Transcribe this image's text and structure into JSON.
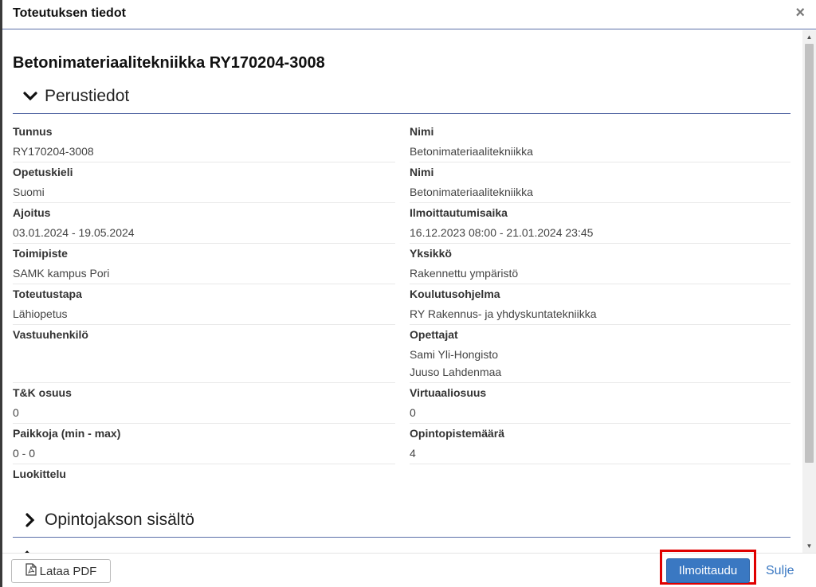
{
  "dialog": {
    "title": "Toteutuksen tiedot",
    "close_symbol": "×"
  },
  "course_title": "Betonimateriaalitekniikka RY170204-3008",
  "sections": {
    "basic": "Perustiedot",
    "content": "Opintojakson sisältö"
  },
  "fields": [
    {
      "label": "Tunnus",
      "values": [
        "RY170204-3008"
      ]
    },
    {
      "label": "Nimi",
      "values": [
        "Betonimateriaalitekniikka"
      ]
    },
    {
      "label": "Opetuskieli",
      "values": [
        "Suomi"
      ]
    },
    {
      "label": "Nimi",
      "values": [
        "Betonimateriaalitekniikka"
      ]
    },
    {
      "label": "Ajoitus",
      "values": [
        "03.01.2024 - 19.05.2024"
      ]
    },
    {
      "label": "Ilmoittautumisaika",
      "values": [
        "16.12.2023 08:00 - 21.01.2024 23:45"
      ]
    },
    {
      "label": "Toimipiste",
      "values": [
        "SAMK kampus Pori"
      ]
    },
    {
      "label": "Yksikkö",
      "values": [
        "Rakennettu ympäristö"
      ]
    },
    {
      "label": "Toteutustapa",
      "values": [
        "Lähiopetus"
      ]
    },
    {
      "label": "Koulutusohjelma",
      "values": [
        "RY Rakennus- ja yhdyskuntatekniikka"
      ]
    },
    {
      "label": "Vastuuhenkilö",
      "values": []
    },
    {
      "label": "Opettajat",
      "values": [
        "Sami Yli-Hongisto",
        "Juuso Lahdenmaa"
      ]
    },
    {
      "label": "T&K osuus",
      "values": [
        "0"
      ]
    },
    {
      "label": "Virtuaaliosuus",
      "values": [
        "0"
      ]
    },
    {
      "label": "Paikkoja (min - max)",
      "values": [
        "0 - 0"
      ]
    },
    {
      "label": "Opintopistemäärä",
      "values": [
        "4"
      ]
    },
    {
      "label": "Luokittelu",
      "values": []
    }
  ],
  "footer": {
    "pdf_label": "Lataa PDF",
    "enroll_label": "Ilmoittaudu",
    "close_label": "Sulje"
  },
  "colors": {
    "accent": "#3a78c2",
    "highlight": "#e00000",
    "divider": "#5b6fa8"
  },
  "icons": {
    "close": "close-icon",
    "chevron_down": "chevron-down-icon",
    "chevron_right": "chevron-right-icon",
    "pdf": "pdf-file-icon"
  }
}
